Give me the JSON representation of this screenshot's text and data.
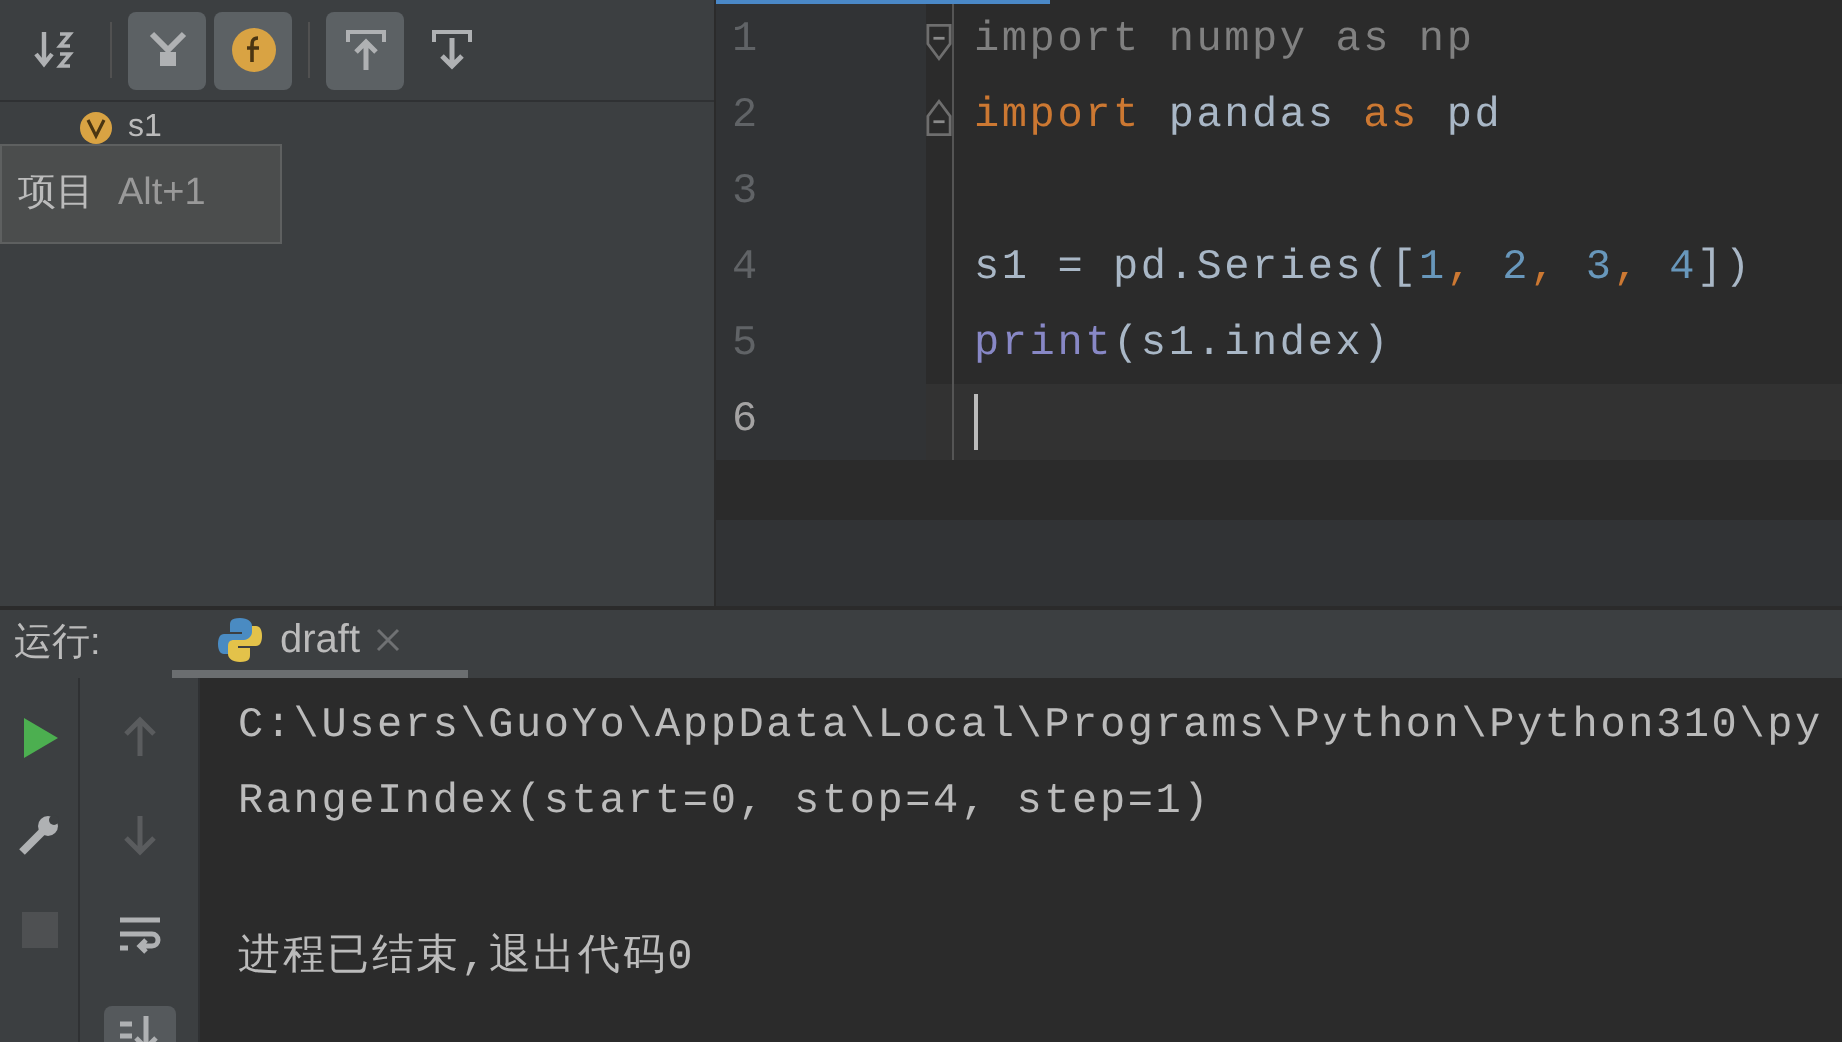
{
  "structure_toolbar": {
    "buttons": [
      {
        "kind": "sort",
        "selected": false
      },
      {
        "kind": "fields",
        "selected": true
      },
      {
        "kind": "functions",
        "selected": true
      },
      {
        "kind": "expand",
        "selected": true
      },
      {
        "kind": "collapse",
        "selected": false
      }
    ]
  },
  "structure_tree": {
    "items": [
      {
        "label": "s1"
      }
    ]
  },
  "tooltip": {
    "label": "项目",
    "shortcut": "Alt+1"
  },
  "editor": {
    "lines": [
      {
        "number": "1",
        "current": false,
        "kind": "fold_start",
        "tokens": [
          {
            "text": "import numpy as np",
            "kind": "unused"
          }
        ]
      },
      {
        "number": "2",
        "current": false,
        "kind": "fold_end",
        "tokens": [
          {
            "text": "import",
            "kind": "keyword"
          },
          {
            "text": " pandas ",
            "kind": "plain"
          },
          {
            "text": "as",
            "kind": "keyword"
          },
          {
            "text": " pd",
            "kind": "plain"
          }
        ]
      },
      {
        "number": "3",
        "current": false,
        "kind": "plain"
      },
      {
        "number": "4",
        "current": false,
        "kind": "plain",
        "tokens": [
          {
            "text": "s1 = pd.Series([",
            "kind": "plain"
          },
          {
            "text": "1",
            "kind": "number"
          },
          {
            "text": ", ",
            "kind": "punct"
          },
          {
            "text": "2",
            "kind": "number"
          },
          {
            "text": ", ",
            "kind": "punct"
          },
          {
            "text": "3",
            "kind": "number"
          },
          {
            "text": ", ",
            "kind": "punct"
          },
          {
            "text": "4",
            "kind": "number"
          },
          {
            "text": "])",
            "kind": "plain"
          }
        ]
      },
      {
        "number": "5",
        "current": false,
        "kind": "plain",
        "tokens": [
          {
            "text": "print",
            "kind": "builtin"
          },
          {
            "text": "(s1.index)",
            "kind": "plain"
          }
        ]
      },
      {
        "number": "6",
        "current": true,
        "kind": "plain"
      }
    ]
  },
  "run_panel": {
    "label": "运行:",
    "tabs": [
      {
        "label": "draft",
        "selected": true
      }
    ]
  },
  "run_toolbar": {
    "buttons": [
      {
        "kind": "rerun",
        "disabled": false
      },
      {
        "kind": "settings",
        "disabled": false
      },
      {
        "kind": "stop",
        "disabled": true
      }
    ]
  },
  "console_toolbar": {
    "buttons": [
      {
        "kind": "up",
        "disabled": true
      },
      {
        "kind": "down",
        "disabled": true
      },
      {
        "kind": "wrap",
        "selected": false
      },
      {
        "kind": "scroll_end",
        "selected": true
      }
    ]
  },
  "console": {
    "lines": [
      {
        "kind": "output",
        "text": "C:\\Users\\GuoYo\\AppData\\Local\\Programs\\Python\\Python310\\py"
      },
      {
        "kind": "output",
        "text": "RangeIndex(start=0, stop=4, step=1)"
      },
      {
        "kind": "status",
        "text": "进程已结束,退出代码0"
      }
    ]
  }
}
